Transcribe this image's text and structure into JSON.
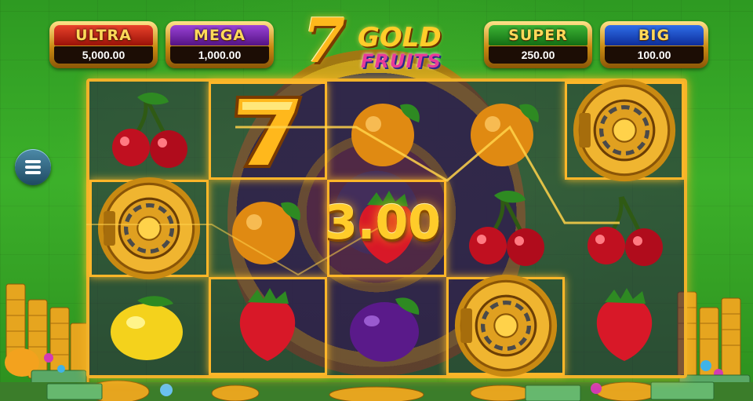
{
  "jackpots": [
    {
      "name": "ULTRA",
      "value": "5,000.00",
      "color": "#c0230f"
    },
    {
      "name": "MEGA",
      "value": "1,000.00",
      "color": "#7a2bb0"
    },
    {
      "name": "SUPER",
      "value": "250.00",
      "color": "#22901f"
    },
    {
      "name": "BIG",
      "value": "100.00",
      "color": "#1c4ac8"
    }
  ],
  "logo": {
    "seven": "7",
    "gold": "GOLD",
    "fruits": "FRUITS"
  },
  "menu": {
    "icon": "hamburger-menu-icon"
  },
  "reels": {
    "columns": 5,
    "rows": 3,
    "symbols": [
      [
        "cherry",
        "seven",
        "orange",
        "orange",
        "vault"
      ],
      [
        "vault",
        "orange",
        "strawberry",
        "cherry",
        "cherry"
      ],
      [
        "lemon",
        "strawberry",
        "plum",
        "vault",
        "strawberry"
      ]
    ],
    "winning_cells": [
      [
        0,
        1
      ],
      [
        0,
        4
      ],
      [
        1,
        0
      ],
      [
        1,
        2
      ],
      [
        2,
        1
      ],
      [
        2,
        3
      ]
    ]
  },
  "win": {
    "amount": "3.00"
  },
  "colors": {
    "frame": "#f1b22a",
    "win_text": "#ffcc2a",
    "background": "#3cb02a"
  }
}
